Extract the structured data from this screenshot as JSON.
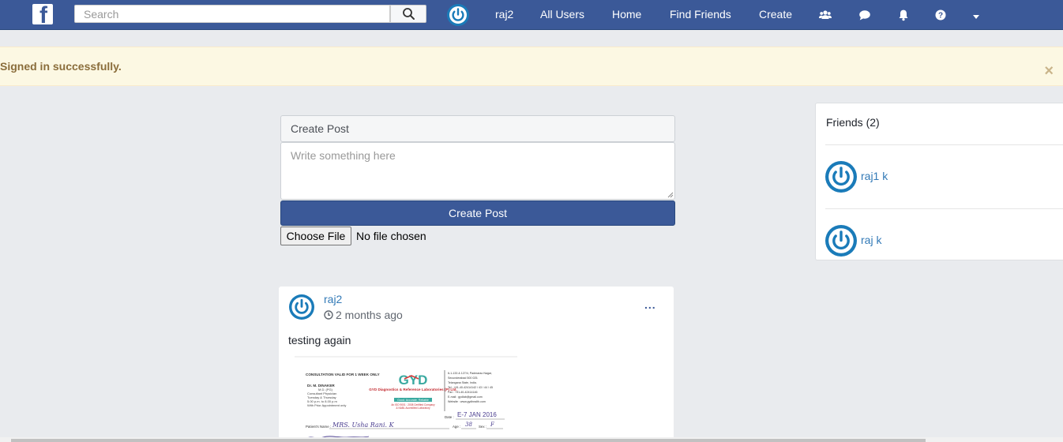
{
  "navbar": {
    "search_placeholder": "Search",
    "links": {
      "username": "raj2",
      "all_users": "All Users",
      "home": "Home",
      "find_friends": "Find Friends",
      "create": "Create"
    },
    "icons": [
      "facebook-logo-icon",
      "search-icon",
      "friend-requests-icon",
      "messages-icon",
      "notifications-icon",
      "help-icon",
      "dropdown-caret-icon"
    ]
  },
  "alert": {
    "message": "Signed in successfully.",
    "close": "×"
  },
  "create_post": {
    "title": "Create Post",
    "placeholder": "Write something here",
    "button_label": "Create Post",
    "file_button": "Choose File",
    "file_status": "No file chosen"
  },
  "post": {
    "author": "raj2",
    "time": "2 months ago",
    "menu": "...",
    "text": "testing again",
    "image": {
      "header_left": "CONSULTATION VALID FOR 1 WEEK ONLY",
      "doctor_name": "Dr. M. DINAKER",
      "doctor_degree": "M.D. (PG)",
      "doctor_role": "Consultant Physician",
      "doctor_days": "Tuesday & Thursday",
      "doctor_hours": "5.00 p.m. to 8.00 p.m",
      "doctor_note": "With Prior Appointment only",
      "logo": "GYD",
      "lab_name": "GYD Diagnostics & Reference Laboratories (P) Ltd.",
      "lab_tagline": "Good. Accurate. Reliable",
      "lab_cert1": "An ISO 9001 : 2008 Certified Company",
      "lab_cert2": "& NABL Accredited Laboratory",
      "addr1": "6-1-133 & 127/4, Padmarao Nagar,",
      "addr2": "Secunderabad 500 025.",
      "addr3": "Telangana State, India.",
      "tel": "Tel : +91-40-42414142 / 43 / 44 / 45",
      "fax": "Fax : +91-40-42414146",
      "email": "E-mail : gydlab@gmail.com",
      "website": "Website : www.gydhealth.com",
      "date_label": "Date :",
      "date_value": "E-7 JAN 2016",
      "patient_label": "Patient's Name :",
      "patient_value": "MRS. Usha Rani. K",
      "age_label": "Age :",
      "age_value": "38",
      "sex_label": "Sex :",
      "sex_value": "F"
    }
  },
  "friends": {
    "title": "Friends (2)",
    "items": [
      {
        "name": "raj1 k"
      },
      {
        "name": "raj k"
      }
    ]
  },
  "colors": {
    "navbar": "#3b5998",
    "page_bg": "#e9ebee",
    "alert_bg": "#fcf8e3",
    "alert_text": "#8a6d3b",
    "link": "#337ab7",
    "avatar": "#1a7bb9"
  }
}
